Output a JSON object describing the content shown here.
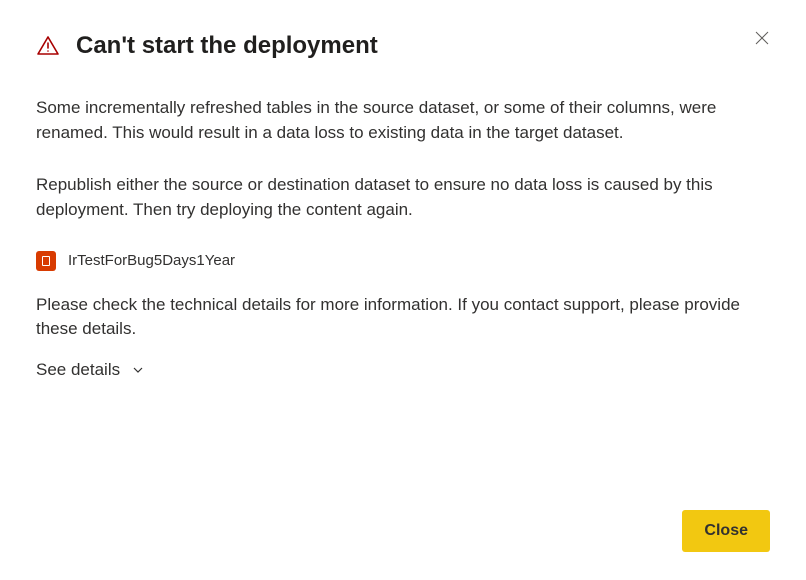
{
  "dialog": {
    "title": "Can't start the deployment",
    "message_1": "Some incrementally refreshed tables in the source dataset, or some of their columns, were renamed. This would result in a data loss to existing data in the target dataset.",
    "message_2": "Republish either the source or destination dataset to ensure no data loss is caused by this deployment. Then try deploying the content again.",
    "dataset_name": "IrTestForBug5Days1Year",
    "message_3": "Please check the technical details for more information. If you contact support, please provide these details.",
    "see_details_label": "See details",
    "close_button_label": "Close"
  },
  "colors": {
    "warning": "#a80000",
    "dataset_icon": "#d83b01",
    "primary_button": "#f2c811"
  }
}
